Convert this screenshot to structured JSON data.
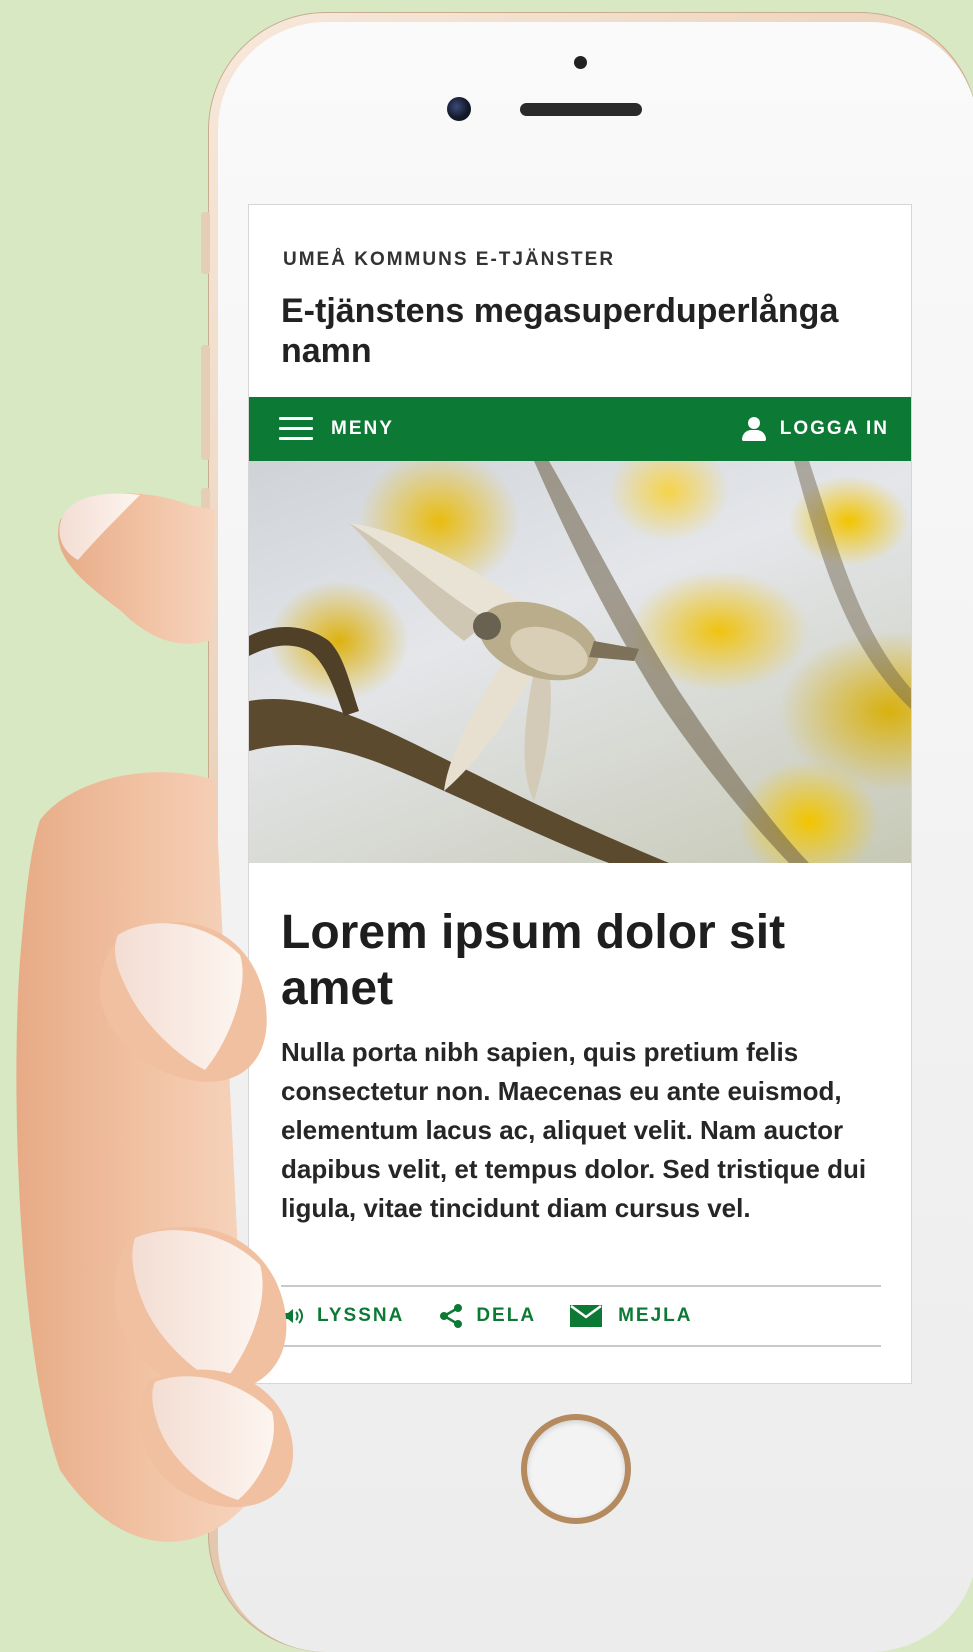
{
  "header": {
    "brand": "UMEÅ KOMMUNS E-TJÄNSTER",
    "service_title": "E-tjänstens megasuperduperlånga namn"
  },
  "navbar": {
    "menu_label": "MENY",
    "menu_icon": "hamburger-menu-icon",
    "login_label": "LOGGA IN",
    "login_icon": "user-icon",
    "color": "#0c7a35"
  },
  "hero": {
    "image": "bird-in-flight-among-yellow-leaves"
  },
  "article": {
    "title": "Lorem ipsum dolor sit amet",
    "body": "Nulla porta nibh sapien, quis pretium felis consectetur non. Maecenas eu ante euismod, elementum lacus ac, aliquet velit. Nam auctor dapibus velit, et tempus dolor. Sed tristique dui ligula, vitae tincidunt diam cursus vel."
  },
  "actions": [
    {
      "label": "LYSSNA",
      "icon": "speaker-icon"
    },
    {
      "label": "DELA",
      "icon": "share-icon"
    },
    {
      "label": "MEJLA",
      "icon": "envelope-icon"
    }
  ]
}
